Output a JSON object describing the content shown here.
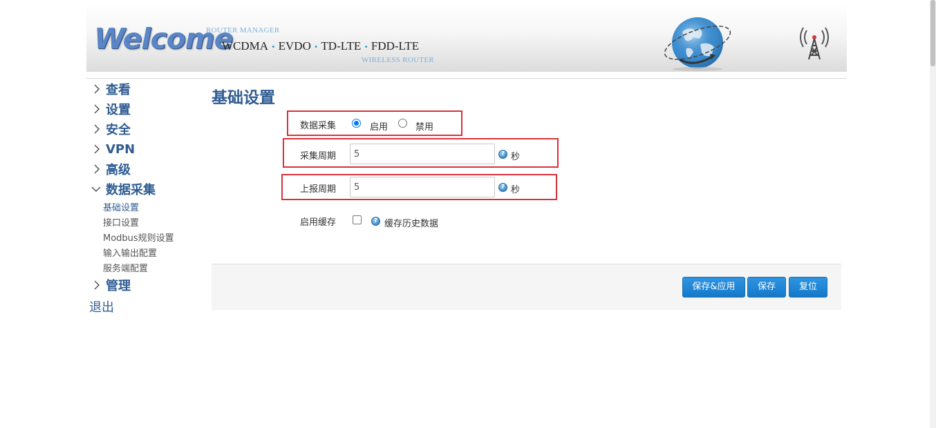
{
  "header": {
    "logo_text": "Welcome",
    "router_manager": "ROUTER MANAGER",
    "technologies": [
      "WCDMA",
      "EVDO",
      "TD-LTE",
      "FDD-LTE"
    ],
    "wireless_router": "WIRELESS ROUTER"
  },
  "sidebar": {
    "items": [
      {
        "label": "查看",
        "state": "collapsed"
      },
      {
        "label": "设置",
        "state": "collapsed"
      },
      {
        "label": "安全",
        "state": "collapsed"
      },
      {
        "label": "VPN",
        "state": "collapsed"
      },
      {
        "label": "高级",
        "state": "collapsed"
      },
      {
        "label": "数据采集",
        "state": "expanded"
      }
    ],
    "sub_items": [
      {
        "label": "基础设置",
        "active": true
      },
      {
        "label": "接口设置"
      },
      {
        "label": "Modbus规则设置"
      },
      {
        "label": "输入输出配置"
      },
      {
        "label": "服务端配置"
      }
    ],
    "after_items": [
      {
        "label": "管理",
        "state": "collapsed"
      }
    ],
    "logout": "退出"
  },
  "main": {
    "title": "基础设置",
    "data_collection": {
      "label": "数据采集",
      "options": [
        "启用",
        "禁用"
      ],
      "selected": "启用"
    },
    "collect_period": {
      "label": "采集周期",
      "value": "5",
      "unit": "秒"
    },
    "report_period": {
      "label": "上报周期",
      "value": "5",
      "unit": "秒"
    },
    "enable_cache": {
      "label": "启用缓存",
      "checked": false,
      "hint": "缓存历史数据"
    }
  },
  "actions": {
    "save_apply": "保存&应用",
    "save": "保存",
    "reset": "复位"
  },
  "colors": {
    "nav_blue": "#2f5c93",
    "button_blue": "#1578c9",
    "highlight_red": "#d9303a"
  }
}
